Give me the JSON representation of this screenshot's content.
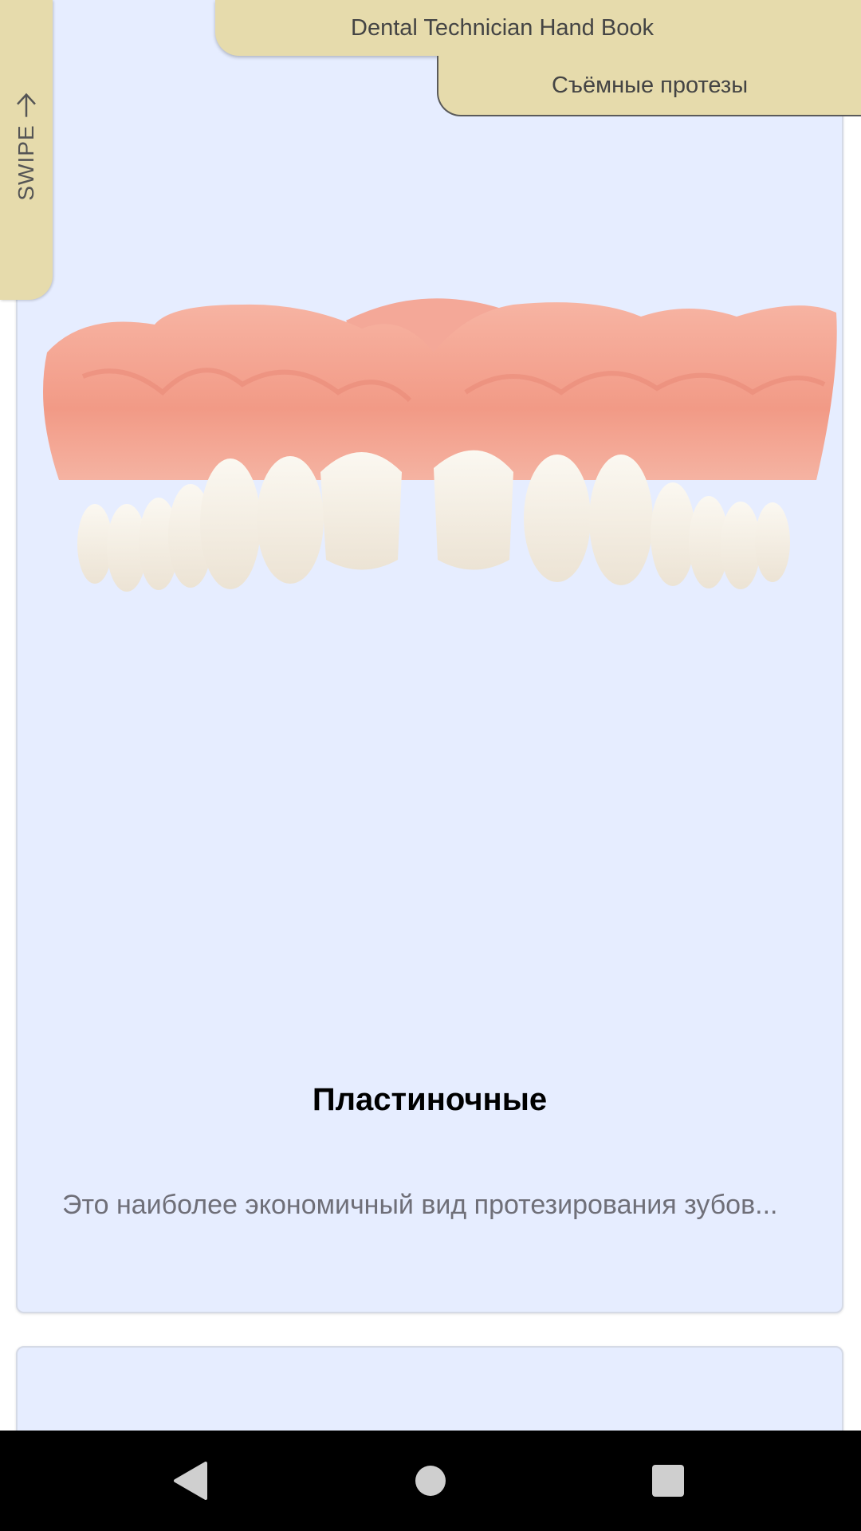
{
  "app": {
    "title": "Dental Technician Hand Book",
    "section": "Съёмные протезы",
    "swipe_label": "SWIPE"
  },
  "card": {
    "title": "Пластиночные",
    "description": "Это наиболее экономичный вид протезирования зубов...",
    "image_icon": "denture-image"
  },
  "navbar": {
    "back_icon": "back-triangle-icon",
    "home_icon": "home-circle-icon",
    "recent_icon": "recent-square-icon"
  },
  "colors": {
    "tab": "#e6dbac",
    "card": "#e6edff",
    "gum": "#f2a08e",
    "teeth": "#f4efe6"
  }
}
